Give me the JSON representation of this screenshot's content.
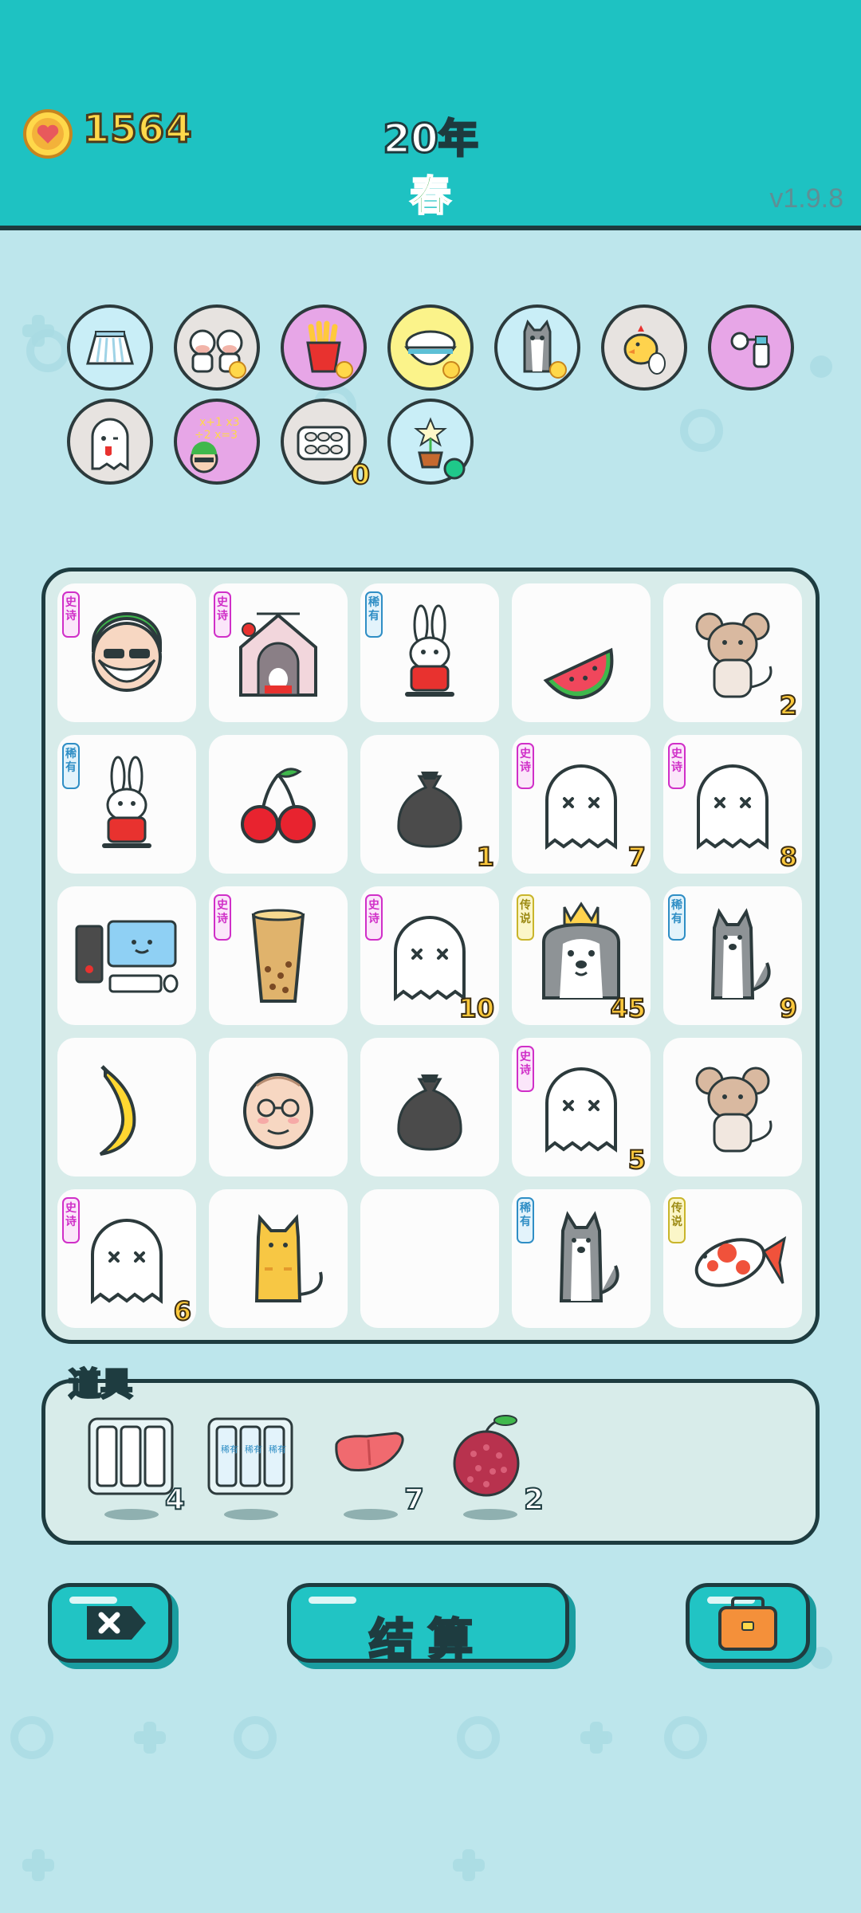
{
  "header": {
    "coins": "1564",
    "year": "20年",
    "season": "春",
    "version": "v1.9.8",
    "coin_icon": "heart-coin-icon"
  },
  "status_icons": [
    {
      "name": "skirt-icon",
      "bg": "#c9eef7"
    },
    {
      "name": "cows-icon",
      "bg": "#e7e3e0"
    },
    {
      "name": "fries-icon",
      "bg": "#e7a6e7"
    },
    {
      "name": "rice-bowl-icon",
      "bg": "#fbf38a"
    },
    {
      "name": "husky-icon",
      "bg": "#c9eef7"
    },
    {
      "name": "chick-egg-icon",
      "bg": "#e7e3e0"
    },
    {
      "name": "breast-pump-icon",
      "bg": "#e7a6e7"
    },
    {
      "name": "ghost-icon",
      "bg": "#e7e3e0"
    },
    {
      "name": "math-boy-icon",
      "bg": "#e7a6e7"
    },
    {
      "name": "egg-tray-icon",
      "bg": "#e7e3e0",
      "count": "0"
    },
    {
      "name": "flower-pot-icon",
      "bg": "#c9eef7"
    }
  ],
  "grid": [
    [
      {
        "item": "bearded-man-icon",
        "tag": "史诗",
        "tag_type": "epic",
        "count": ""
      },
      {
        "item": "rabbit-house-icon",
        "tag": "史诗",
        "tag_type": "epic",
        "count": ""
      },
      {
        "item": "rabbit-icon",
        "tag": "稀有",
        "tag_type": "rare",
        "count": ""
      },
      {
        "item": "watermelon-icon",
        "tag": "",
        "tag_type": "",
        "count": ""
      },
      {
        "item": "mouse-icon",
        "tag": "",
        "tag_type": "",
        "count": "2"
      }
    ],
    [
      {
        "item": "rabbit-icon",
        "tag": "稀有",
        "tag_type": "rare",
        "count": ""
      },
      {
        "item": "cherry-icon",
        "tag": "",
        "tag_type": "",
        "count": ""
      },
      {
        "item": "garbage-bag-icon",
        "tag": "",
        "tag_type": "",
        "count": "1"
      },
      {
        "item": "ghost-icon",
        "tag": "史诗",
        "tag_type": "epic",
        "count": "7"
      },
      {
        "item": "ghost-icon",
        "tag": "史诗",
        "tag_type": "epic",
        "count": "8"
      }
    ],
    [
      {
        "item": "computer-icon",
        "tag": "",
        "tag_type": "",
        "count": ""
      },
      {
        "item": "bubble-tea-icon",
        "tag": "史诗",
        "tag_type": "epic",
        "count": ""
      },
      {
        "item": "ghost-icon",
        "tag": "史诗",
        "tag_type": "epic",
        "count": "10"
      },
      {
        "item": "crowned-husky-icon",
        "tag": "传说",
        "tag_type": "legend",
        "count": "45"
      },
      {
        "item": "husky-icon",
        "tag": "稀有",
        "tag_type": "rare",
        "count": "9"
      }
    ],
    [
      {
        "item": "banana-icon",
        "tag": "",
        "tag_type": "",
        "count": ""
      },
      {
        "item": "bald-man-icon",
        "tag": "",
        "tag_type": "",
        "count": ""
      },
      {
        "item": "garbage-bag-icon",
        "tag": "",
        "tag_type": "",
        "count": ""
      },
      {
        "item": "ghost-icon",
        "tag": "史诗",
        "tag_type": "epic",
        "count": "5"
      },
      {
        "item": "mouse-icon",
        "tag": "",
        "tag_type": "",
        "count": ""
      }
    ],
    [
      {
        "item": "ghost-icon",
        "tag": "史诗",
        "tag_type": "epic",
        "count": "6"
      },
      {
        "item": "cat-icon",
        "tag": "",
        "tag_type": "",
        "count": ""
      },
      {
        "item": "empty-slot",
        "tag": "",
        "tag_type": "",
        "count": ""
      },
      {
        "item": "husky-icon",
        "tag": "稀有",
        "tag_type": "rare",
        "count": ""
      },
      {
        "item": "koi-fish-icon",
        "tag": "传说",
        "tag_type": "legend",
        "count": ""
      }
    ]
  ],
  "tools": {
    "title": "道具",
    "items": [
      {
        "item": "reroll-blank-icon",
        "count": "4"
      },
      {
        "item": "reroll-rare-icon",
        "count": ""
      },
      {
        "item": "liver-icon",
        "count": "7"
      },
      {
        "item": "lychee-icon",
        "count": "2"
      }
    ],
    "mini_tag": "稀有"
  },
  "buttons": {
    "exit_icon": "exit-x-icon",
    "settle_label": "结算",
    "bag_icon": "briefcase-icon"
  },
  "colors": {
    "header_bg": "#1ec2c2",
    "page_bg": "#bde6ec",
    "coin_text": "#ffd84a",
    "season_text": "#1aa02c",
    "epic": "#d02fc8",
    "rare": "#2f8ec5",
    "legend": "#c9b52b"
  }
}
